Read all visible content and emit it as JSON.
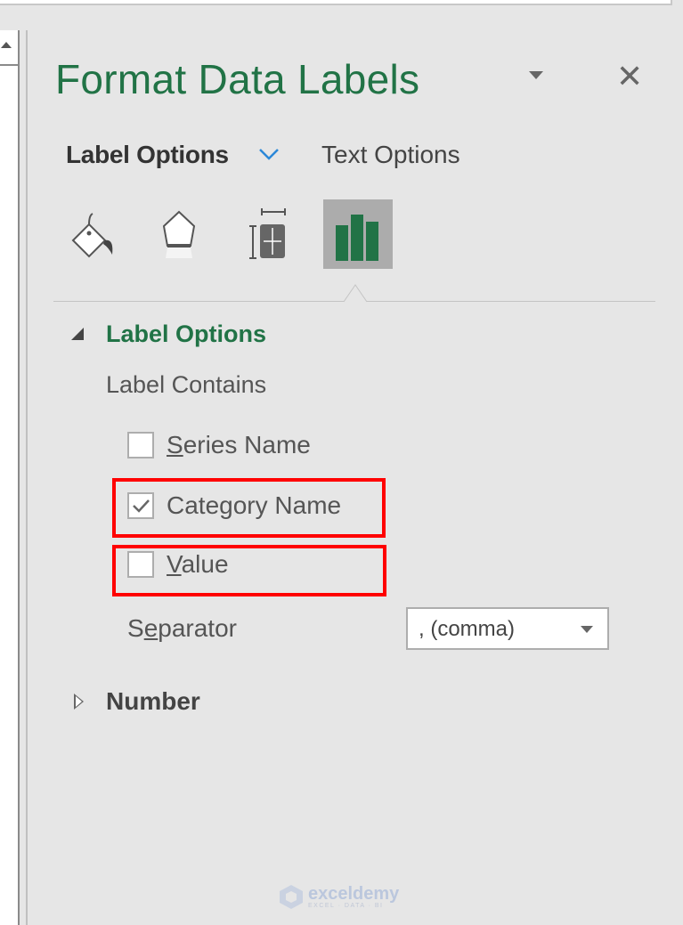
{
  "pane": {
    "title": "Format Data Labels",
    "tabs": [
      {
        "label": "Label Options",
        "active": true
      },
      {
        "label": "Text Options",
        "active": false
      }
    ],
    "icons": [
      {
        "name": "fill-line-icon",
        "selected": false
      },
      {
        "name": "effects-icon",
        "selected": false
      },
      {
        "name": "size-properties-icon",
        "selected": false
      },
      {
        "name": "label-options-chart-icon",
        "selected": true
      }
    ],
    "section": {
      "title": "Label Options",
      "expanded": true,
      "subheading": "Label Contains",
      "checkboxes": [
        {
          "label_pre": "",
          "mnemonic": "S",
          "label_post": "eries Name",
          "checked": false,
          "highlighted": false
        },
        {
          "label_pre": "Cate",
          "mnemonic": "g",
          "label_post": "ory Name",
          "checked": true,
          "highlighted": true
        },
        {
          "label_pre": "",
          "mnemonic": "V",
          "label_post": "alue",
          "checked": false,
          "highlighted": true
        }
      ],
      "separator": {
        "label_pre": "S",
        "mnemonic": "e",
        "label_post": "parator",
        "value": ", (comma)"
      }
    },
    "collapsed_section": {
      "title": "Number",
      "expanded": false
    }
  },
  "colors": {
    "accent_green": "#217346",
    "highlight_red": "#ff0000",
    "pane_bg": "#e6e6e6"
  },
  "watermark": {
    "name": "exceldemy",
    "tagline": "EXCEL · DATA · BI"
  }
}
